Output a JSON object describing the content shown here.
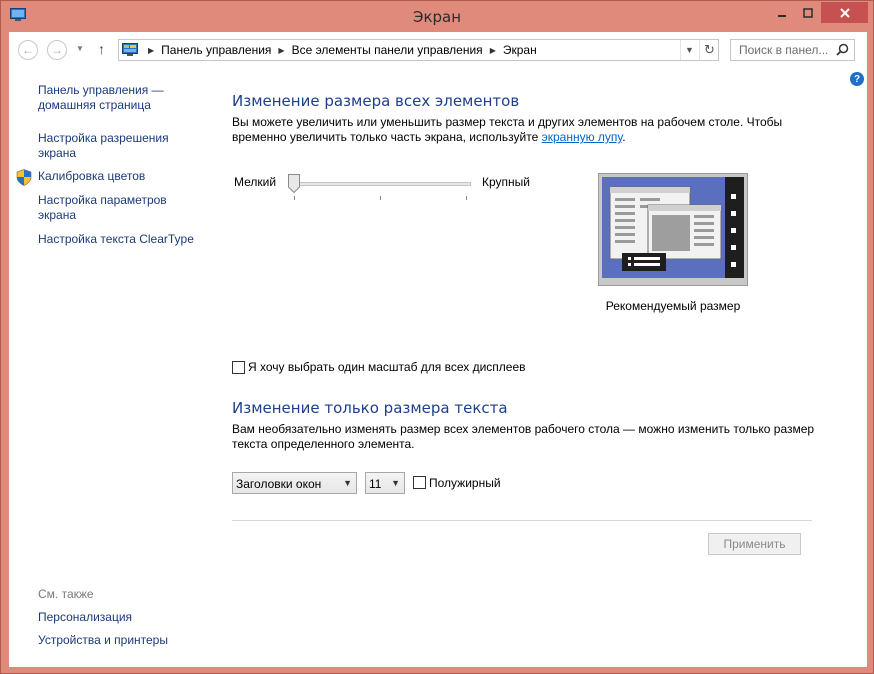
{
  "window": {
    "title": "Экран"
  },
  "controls": {
    "minimize_icon": "minimize-icon",
    "maximize_icon": "maximize-icon",
    "close_icon": "close-icon"
  },
  "navigation": {
    "breadcrumbs": [
      "Панель управления",
      "Все элементы панели управления",
      "Экран"
    ],
    "search_placeholder": "Поиск в панел..."
  },
  "sidebar": {
    "links": [
      {
        "label": "Панель управления — домашняя страница"
      },
      {
        "label": "Настройка разрешения экрана"
      },
      {
        "label": "Калибровка цветов"
      },
      {
        "label": "Настройка параметров экрана"
      },
      {
        "label": "Настройка текста ClearType"
      }
    ],
    "see_also_label": "См. также",
    "see_also_links": [
      {
        "label": "Персонализация"
      },
      {
        "label": "Устройства и принтеры"
      }
    ]
  },
  "main": {
    "section1": {
      "heading": "Изменение размера всех элементов",
      "desc_part1": "Вы можете увеличить или уменьшить размер текста и других элементов на рабочем столе. Чтобы временно увеличить только часть экрана, используйте ",
      "desc_link": "экранную лупу",
      "desc_part2": ".",
      "slider_min_label": "Мелкий",
      "slider_max_label": "Крупный",
      "slider_value": 0,
      "preview_caption": "Рекомендуемый размер",
      "checkbox_label": "Я хочу выбрать один масштаб для всех дисплеев",
      "checkbox_checked": false
    },
    "section2": {
      "heading": "Изменение только размера текста",
      "desc": "Вам необязательно изменять размер всех элементов рабочего стола — можно изменить только размер текста определенного элемента.",
      "element_select_value": "Заголовки окон",
      "size_select_value": "11",
      "bold_label": "Полужирный",
      "bold_checked": false
    },
    "apply_label": "Применить"
  },
  "colors": {
    "window_frame": "#e08a7c",
    "heading": "#1e3f8c",
    "link": "#1b3a7a",
    "close_button": "#c75050"
  }
}
